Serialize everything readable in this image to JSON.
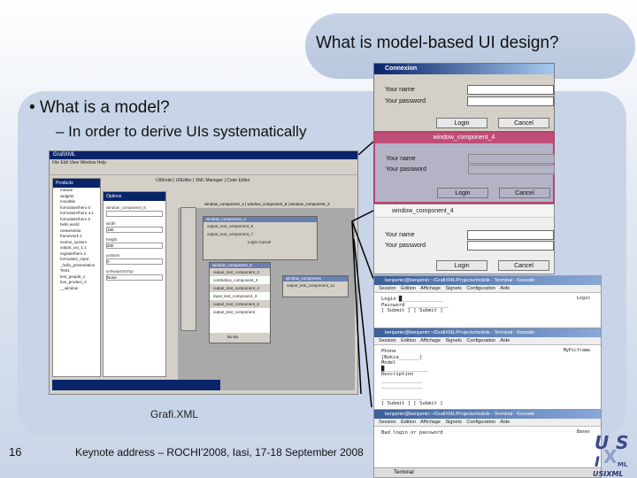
{
  "slide": {
    "title": "What is model-based UI design?",
    "bullet": "• What is a model?",
    "sub_bullet": "– In order to derive UIs systematically",
    "caption": "Grafi.XML",
    "page_number": "16",
    "footer": "Keynote address – ROCHI'2008, Iasi, 17-18 September 2008",
    "logo_text": "USIXML"
  },
  "grafixml": {
    "title": "GrafiXML",
    "menu": "File  Edit  View  Window  Help",
    "tree_header": "Products",
    "tree_items": [
      "mwaze",
      "widget2",
      "movable",
      "formulaire/hero 6",
      "formulaire/hero 4.1",
      "formulaire/hero 5",
      "hello world",
      "newwindow",
      "framework 2",
      "ex4ms_system",
      "output_uiu_1.1",
      "register/hero 2",
      "formulaire_input",
      "_hello_presentation",
      "Test1",
      "test_people_1",
      "box_product_2",
      "__window"
    ],
    "options_header": "Options",
    "options_fields": [
      {
        "label": "window_component_8",
        "value": ""
      },
      {
        "label": "width",
        "value": "150"
      },
      {
        "label": "height",
        "value": "200"
      },
      {
        "label": "position",
        "value": "0"
      },
      {
        "label": "isAlwaysOnTop",
        "value": "None"
      }
    ],
    "tabs": "UIModel | UIEditor | XML Manager | Code Editor",
    "doc_tabs": "window_component_4 | window_component_8 | window_component_2",
    "mini_windows": [
      {
        "title": "window_component_4",
        "rows": [
          "output_text_component_5",
          "output_text_component_7",
          "Login   Cancel"
        ]
      },
      {
        "title": "window_component_8",
        "rows": [
          "output_text_component_3",
          "combobox_component_3",
          "output_text_component_4",
          "input_text_component_3",
          "output_text_component_6",
          "output_text_component",
          "Bu   Bu"
        ]
      },
      {
        "title": "window_component",
        "rows": [
          "output_text_component_11"
        ]
      }
    ]
  },
  "dialogs": [
    {
      "title": "Connexion",
      "name_label": "Your name",
      "password_label": "Your password",
      "login": "Login",
      "cancel": "Cancel"
    },
    {
      "title": "window_component_4",
      "name_label": "Your name",
      "password_label": "Your password",
      "login": "Login",
      "cancel": "Cancel"
    },
    {
      "title": "window_component_4",
      "name_label": "Your name",
      "password_label": "Your password",
      "login": "Login",
      "cancel": "Cancel"
    }
  ],
  "terminals": [
    {
      "title": "benjamin@benjamin:~/GrafiXML/Projects/mobile - Terminal - Konsole",
      "menu": "Session Édition Affichage Signets Configuration Aide",
      "right": "Login",
      "body": "Login █______________\nPassword ______________\n[ Submit ] [ Submit ]"
    },
    {
      "title": "benjamin@benjamin:~/GrafiXML/Projects/mobile - Terminal - Konsole",
      "menu": "Session Édition Affichage Signets Configuration Aide",
      "right": "MyPicframe",
      "body": "Phone\n[Nokia_______]\nModel\n█_______________\nDescription\n______________\n______________\n\n______________\n[ Submit ] [ Submit ]"
    },
    {
      "title": "benjamin@benjamin:~/GrafiXML/Projects/mobile - Terminal - Konsole",
      "menu": "Session Édition Affichage Signets Configuration Aide",
      "right": "Bases",
      "body": "Bad login or password",
      "taskbar": "Terminal"
    }
  ],
  "colors": {
    "title_pill": "#c6d2e5",
    "panel": "#c8d4e7",
    "pink_window": "#c04d78",
    "xp_titlebar": "#0a246a"
  }
}
